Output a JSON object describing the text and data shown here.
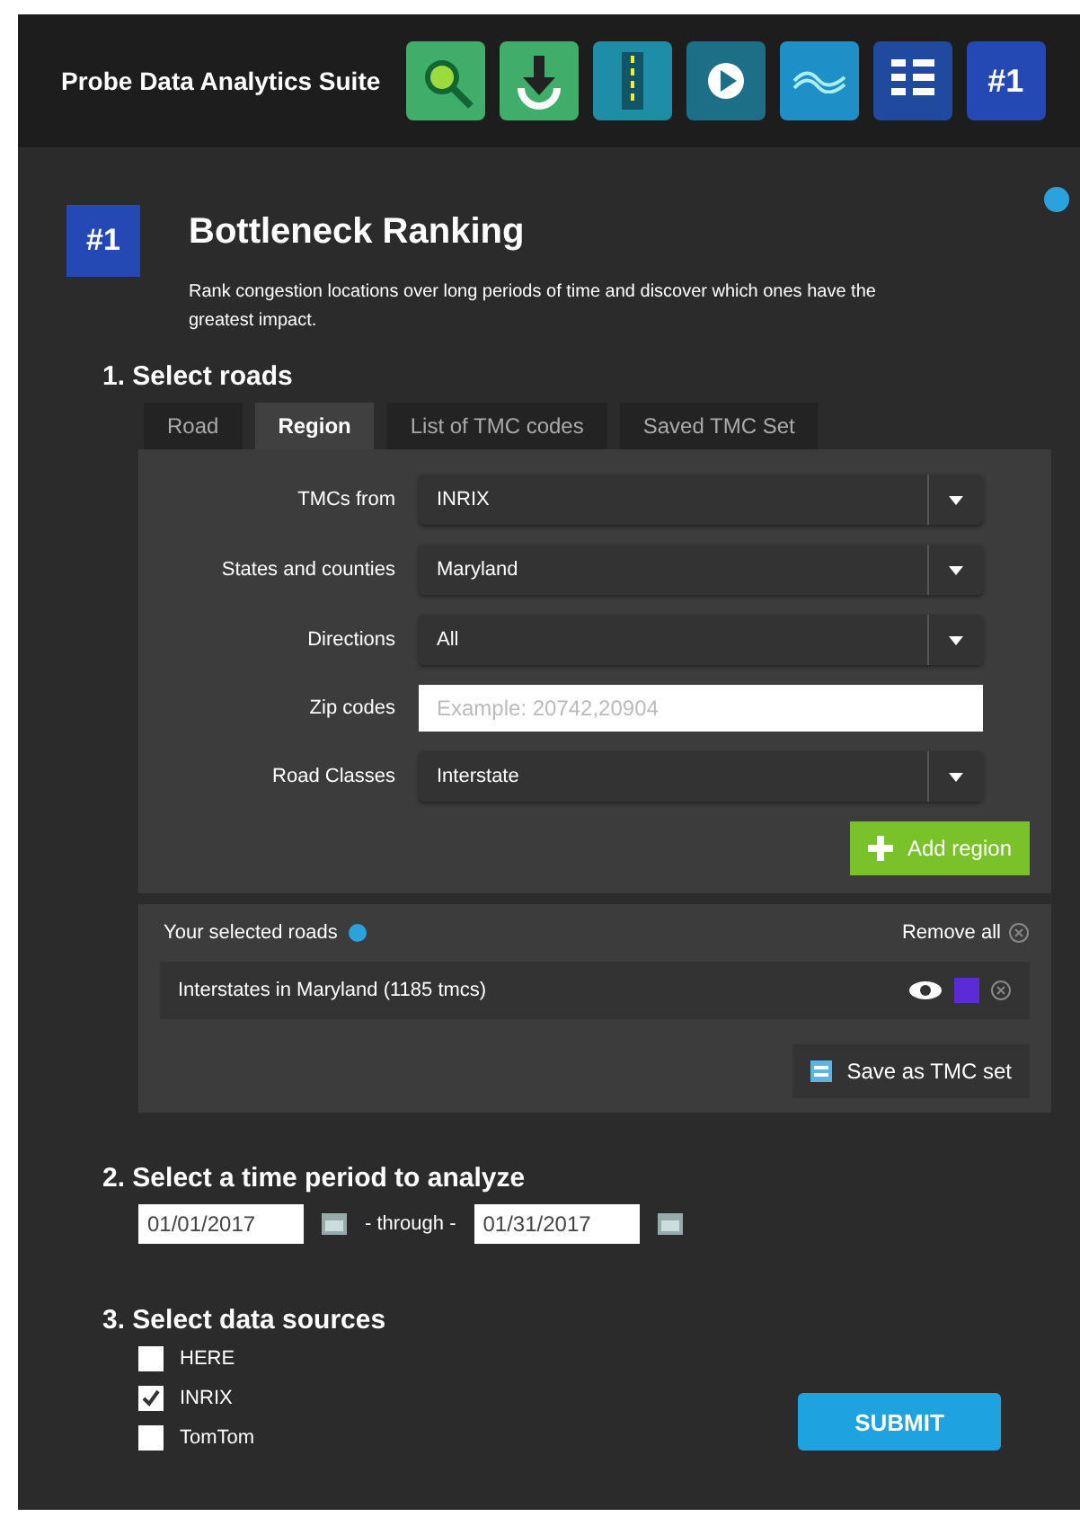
{
  "header": {
    "title": "Probe Data Analytics Suite",
    "tools": [
      {
        "kind": "search"
      },
      {
        "kind": "download"
      },
      {
        "kind": "road"
      },
      {
        "kind": "play"
      },
      {
        "kind": "wave"
      },
      {
        "kind": "list"
      },
      {
        "kind": "badge",
        "label": "#1"
      }
    ]
  },
  "tool": {
    "badge": "#1",
    "title": "Bottleneck Ranking",
    "description": "Rank congestion locations over long periods of time and discover which ones have the greatest impact."
  },
  "roads": {
    "heading": "1. Select roads",
    "tabs": [
      {
        "label": "Road",
        "selected": false
      },
      {
        "label": "Region",
        "selected": true
      },
      {
        "label": "List of TMC codes",
        "selected": false
      },
      {
        "label": "Saved TMC Set",
        "selected": false
      }
    ],
    "fields": [
      {
        "kind": "select",
        "label": "TMCs from",
        "value": "INRIX"
      },
      {
        "kind": "select",
        "label": "States and counties",
        "value": "Maryland"
      },
      {
        "kind": "select",
        "label": "Directions",
        "value": "All"
      },
      {
        "kind": "text",
        "label": "Zip codes",
        "placeholder": "Example: 20742,20904"
      },
      {
        "kind": "select",
        "label": "Road Classes",
        "value": "Interstate"
      }
    ],
    "add_button": "Add region",
    "selected_label": "Your selected roads",
    "remove_all": "Remove all",
    "selected": [
      {
        "label": "Interstates in Maryland (1185 tmcs)",
        "color": "#5a2bd6"
      }
    ],
    "save_button": "Save as TMC set"
  },
  "period": {
    "heading": "2. Select a time period to analyze",
    "from": "01/01/2017",
    "through": "- through -",
    "to": "01/31/2017"
  },
  "sources": {
    "heading": "3. Select data sources",
    "items": [
      {
        "label": "HERE",
        "checked": false
      },
      {
        "label": "INRIX",
        "checked": true
      },
      {
        "label": "TomTom",
        "checked": false
      }
    ],
    "submit": "SUBMIT"
  }
}
